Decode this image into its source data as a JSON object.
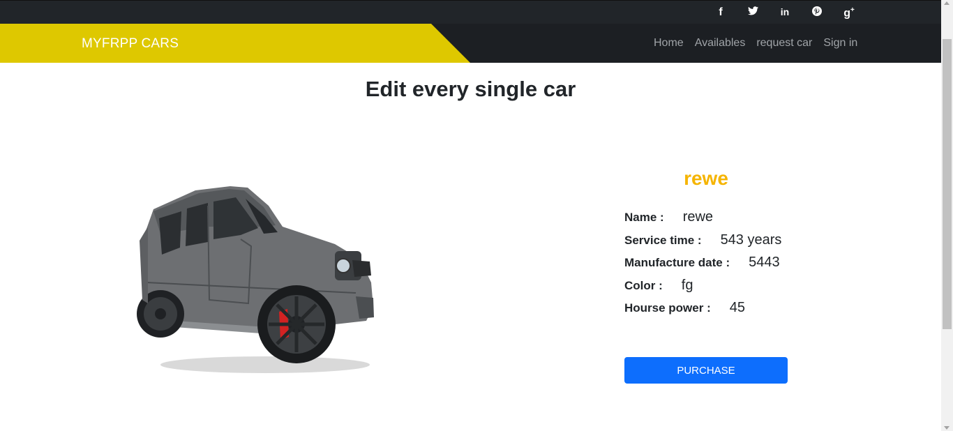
{
  "social": {
    "facebook": "f",
    "twitter": "❝",
    "linkedin": "in",
    "pinterest": "Ⓟ",
    "googleplus": "g+"
  },
  "navbar": {
    "brand": "MYFRPP CARS",
    "links": [
      "Home",
      "Availables",
      "request car",
      "Sign in"
    ]
  },
  "page": {
    "title": "Edit every single car"
  },
  "car": {
    "name_heading": "rewe",
    "specs": [
      {
        "label": "Name :",
        "value": "rewe"
      },
      {
        "label": "Service time :",
        "value": "543 years"
      },
      {
        "label": "Manufacture date :",
        "value": "5443"
      },
      {
        "label": "Color :",
        "value": "fg"
      },
      {
        "label": "Hourse power :",
        "value": "45"
      }
    ],
    "purchase_label": "PURCHASE"
  },
  "colors": {
    "brand_yellow": "#dec800",
    "name_orange": "#f5b400",
    "button_blue": "#0d6efd",
    "dark": "#212529"
  }
}
